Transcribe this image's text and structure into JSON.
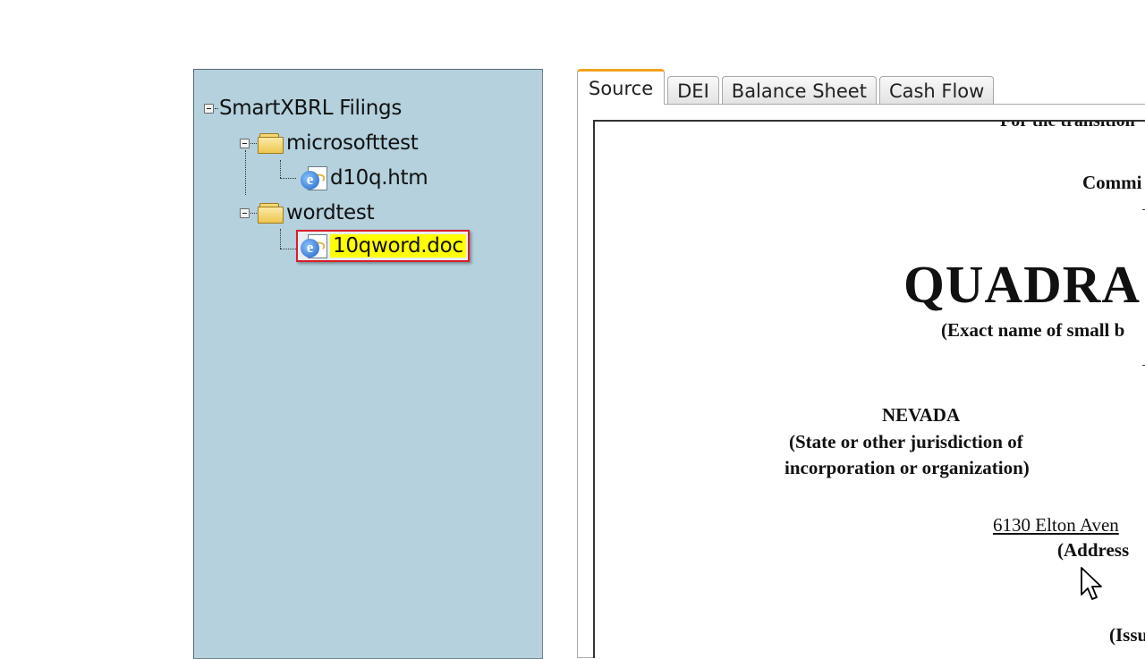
{
  "tree": {
    "root": {
      "label": "SmartXBRL Filings"
    },
    "folders": [
      {
        "label": "microsofttest",
        "files": [
          {
            "label": "d10q.htm"
          }
        ]
      },
      {
        "label": "wordtest",
        "files": [
          {
            "label": "10qword.doc",
            "selected": true
          }
        ]
      }
    ]
  },
  "tabs": [
    {
      "label": "Source",
      "active": true
    },
    {
      "label": "DEI"
    },
    {
      "label": "Balance Sheet"
    },
    {
      "label": "Cash Flow"
    }
  ],
  "document": {
    "transition_fragment": "For the transition",
    "commission_fragment": "Commi",
    "company_name_fragment": "QUADRA",
    "exact_name_fragment": "(Exact name of small b",
    "state": "NEVADA",
    "state_caption_line1": "(State or other jurisdiction of",
    "state_caption_line2": "incorporation or organization)",
    "address_fragment": "6130 Elton Aven",
    "address_caption_fragment": "(Address",
    "issuer_fragment": "(Issu"
  },
  "colors": {
    "panel_bg": "#b4d1dd",
    "highlight": "#ffff00",
    "selection_border": "#d81d2c",
    "active_tab_accent": "#f2a11f"
  }
}
